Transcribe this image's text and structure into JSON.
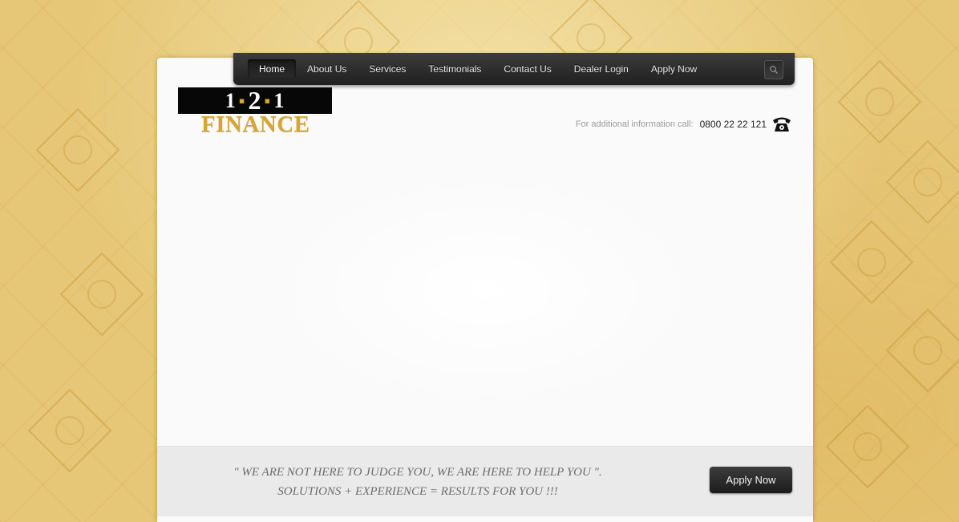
{
  "nav": {
    "items": [
      {
        "label": "Home",
        "active": true
      },
      {
        "label": "About Us",
        "active": false
      },
      {
        "label": "Services",
        "active": false
      },
      {
        "label": "Testimonials",
        "active": false
      },
      {
        "label": "Contact Us",
        "active": false
      },
      {
        "label": "Dealer Login",
        "active": false
      },
      {
        "label": "Apply Now",
        "active": false
      }
    ],
    "search_icon": "search-icon"
  },
  "logo": {
    "top_left": "1",
    "top_mid": "2",
    "top_right": "1",
    "bottom": "FINANCE"
  },
  "contact": {
    "label": "For additional information call:",
    "phone": "0800 22 22 121",
    "icon": "telephone-icon"
  },
  "footer": {
    "slogan_line1": "\" WE ARE NOT HERE TO JUDGE YOU, WE ARE HERE TO HELP YOU \".",
    "slogan_line2": "SOLUTIONS + EXPERIENCE = RESULTS FOR YOU !!!",
    "apply_button": "Apply Now"
  },
  "colors": {
    "background": "#e6c777",
    "nav": "#2b2b2b",
    "logo_gold": "#d7a533",
    "button": "#2a2a2a"
  }
}
